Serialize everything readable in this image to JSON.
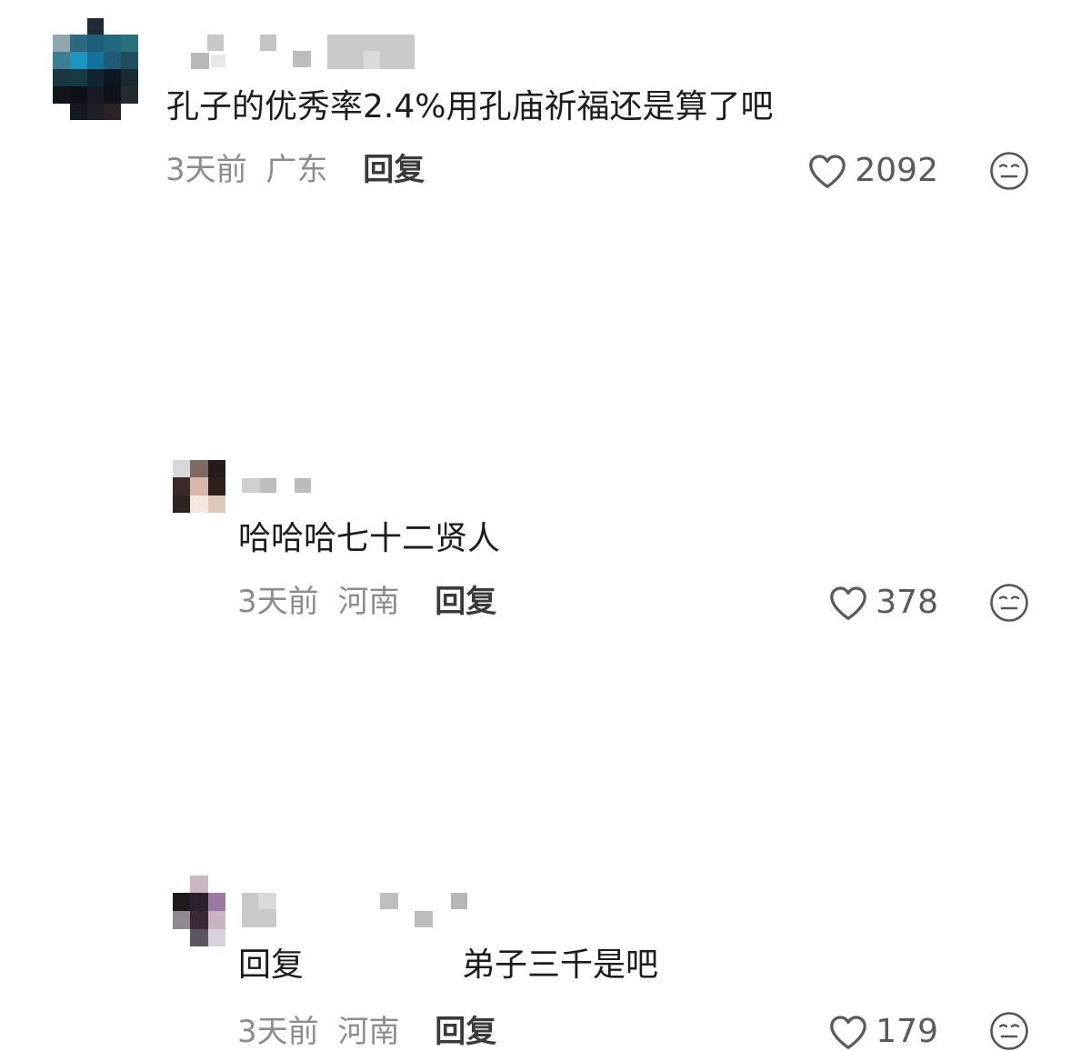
{
  "comments": [
    {
      "text": "孔子的优秀率2.4%用孔庙祈福还是算了吧",
      "time": "3天前",
      "region": "广东",
      "reply_label": "回复",
      "likes": "2092"
    },
    {
      "text": "哈哈哈七十二贤人",
      "time": "3天前",
      "region": "河南",
      "reply_label": "回复",
      "likes": "378"
    },
    {
      "reply_prefix": "回复",
      "text": "弟子三千是吧",
      "time": "3天前",
      "region": "河南",
      "reply_label": "回复",
      "likes": "179"
    }
  ],
  "icons": {
    "like": "heart-outline-icon",
    "emoji": "neutral-face-icon"
  },
  "colors": {
    "text": "#1c1c1c",
    "meta": "#8c8c8c",
    "reply": "#3a3a3a"
  }
}
